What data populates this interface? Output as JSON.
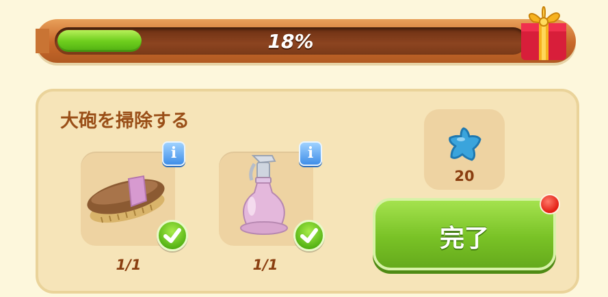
{
  "progress": {
    "percent_label": "18%",
    "value": 0.18
  },
  "task": {
    "title": "大砲を掃除する",
    "items": [
      {
        "icon": "brush-icon",
        "count": "1/1",
        "info_label": "i",
        "completed": true
      },
      {
        "icon": "spray-bottle-icon",
        "count": "1/1",
        "info_label": "i",
        "completed": true
      }
    ],
    "reward": {
      "icon": "blue-star-icon",
      "value": "20"
    },
    "complete_button": {
      "label": "完了",
      "has_notification": true
    }
  },
  "colors": {
    "progress_fill": "#6fcf1e",
    "panel": "#f6e4b8",
    "title_text": "#9a4f18",
    "button_green": "#79c226",
    "notification_red": "#e21d12"
  }
}
